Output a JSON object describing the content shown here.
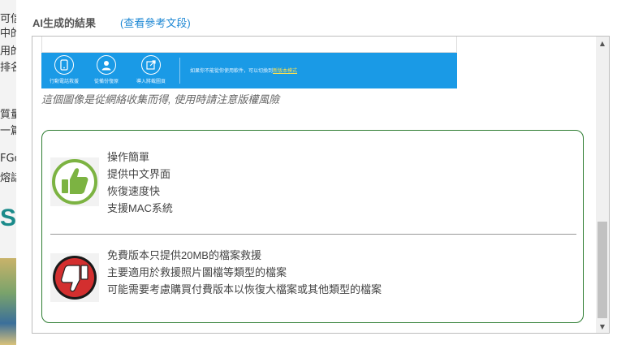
{
  "background_fragments": [
    "可信",
    "中的",
    "用的",
    "排名",
    "質量",
    "一篇",
    "FGo",
    "熔話",
    "S"
  ],
  "header": {
    "title": "AI生成的結果",
    "reference_link": "(查看參考文段)"
  },
  "screenshot": {
    "tools": [
      {
        "label": "行動電話救援",
        "icon": "phone-icon"
      },
      {
        "label": "從備份復原",
        "icon": "user-icon"
      },
      {
        "label": "導入將截圖頁",
        "icon": "import-icon"
      }
    ],
    "message": "如果你不能從你使用軟件，可以切換到",
    "message_link": "新版本模式"
  },
  "caption": "這個圖像是從網絡收集而得, 使用時請注意版權風險",
  "pros": [
    "操作簡單",
    "提供中文界面",
    "恢復速度快",
    "支援MAC系統"
  ],
  "cons": [
    "免費版本只提供20MB的檔案救援",
    "主要適用於救援照片圖檔等類型的檔案",
    "可能需要考慮購買付費版本以恢復大檔案或其他類型的檔案"
  ],
  "colors": {
    "link": "#1e88d4",
    "border_green": "#2e7d32",
    "toolbar_blue": "#1a9ae6",
    "thumbs_up": "#7cb342",
    "thumbs_down": "#d32f2f"
  }
}
